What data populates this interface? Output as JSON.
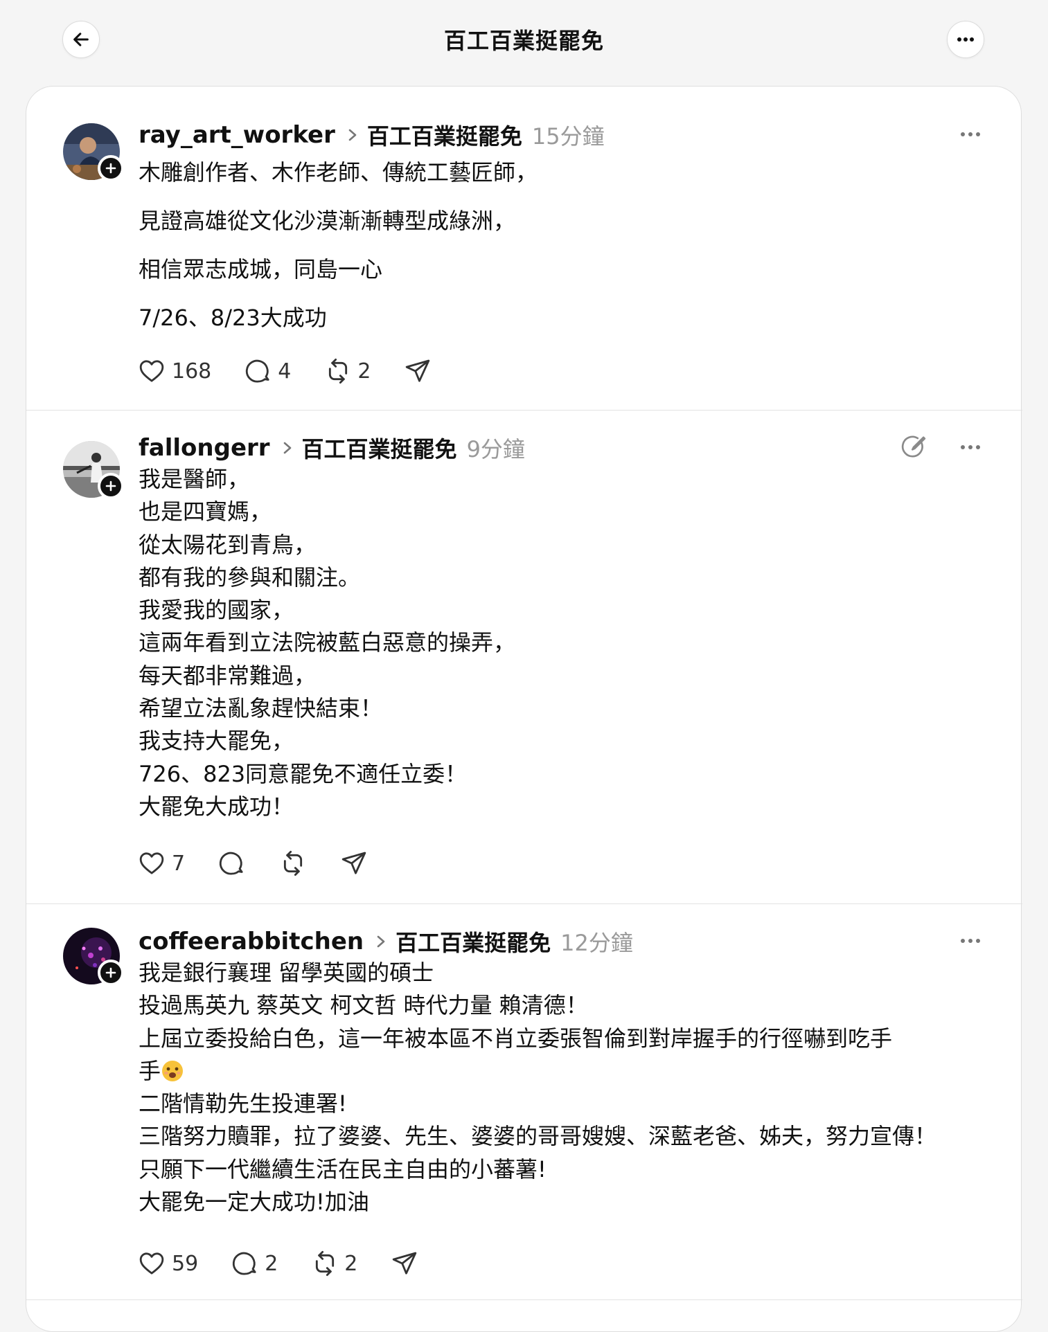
{
  "header": {
    "title": "百工百業挺罷免",
    "back_icon": "arrow-left-icon",
    "more_icon": "ellipsis-icon"
  },
  "posts": [
    {
      "username": "ray_art_worker",
      "community": "百工百業挺罷免",
      "time": "15分鐘",
      "paragraphs": [
        "木雕創作者、木作老師、傳統工藝匠師，",
        "見證高雄從文化沙漠漸漸轉型成綠洲，",
        "相信眾志成城，同島一心",
        "7/26、8/23大成功"
      ],
      "likes": "168",
      "comments": "4",
      "reposts": "2"
    },
    {
      "username": "fallongerr",
      "community": "百工百業挺罷免",
      "time": "9分鐘",
      "lines": [
        "我是醫師，",
        "也是四寶媽，",
        "從太陽花到青鳥，",
        "都有我的參與和關注。",
        "我愛我的國家，",
        "這兩年看到立法院被藍白惡意的操弄，",
        "每天都非常難過，",
        "希望立法亂象趕快結束！",
        "我支持大罷免，",
        "726、823同意罷免不適任立委！",
        "大罷免大成功！"
      ],
      "likes": "7",
      "comments": "",
      "reposts": ""
    },
    {
      "username": "coffeerabbitchen",
      "community": "百工百業挺罷免",
      "time": "12分鐘",
      "lines": [
        "我是銀行襄理 留學英國的碩士",
        "投過馬英九 蔡英文 柯文哲 時代力量 賴清德！",
        "上屆立委投給白色，這一年被本區不肖立委張智倫到對岸握手的行徑嚇到吃手",
        "手",
        "二階情勒先生投連署!",
        "三階努力贖罪，拉了婆婆、先生、婆婆的哥哥嫂嫂、深藍老爸、姊夫，努力宣傳！",
        "只願下一代繼續生活在民主自由的小蕃薯!",
        "大罷免一定大成功!加油"
      ],
      "likes": "59",
      "comments": "2",
      "reposts": "2"
    }
  ]
}
